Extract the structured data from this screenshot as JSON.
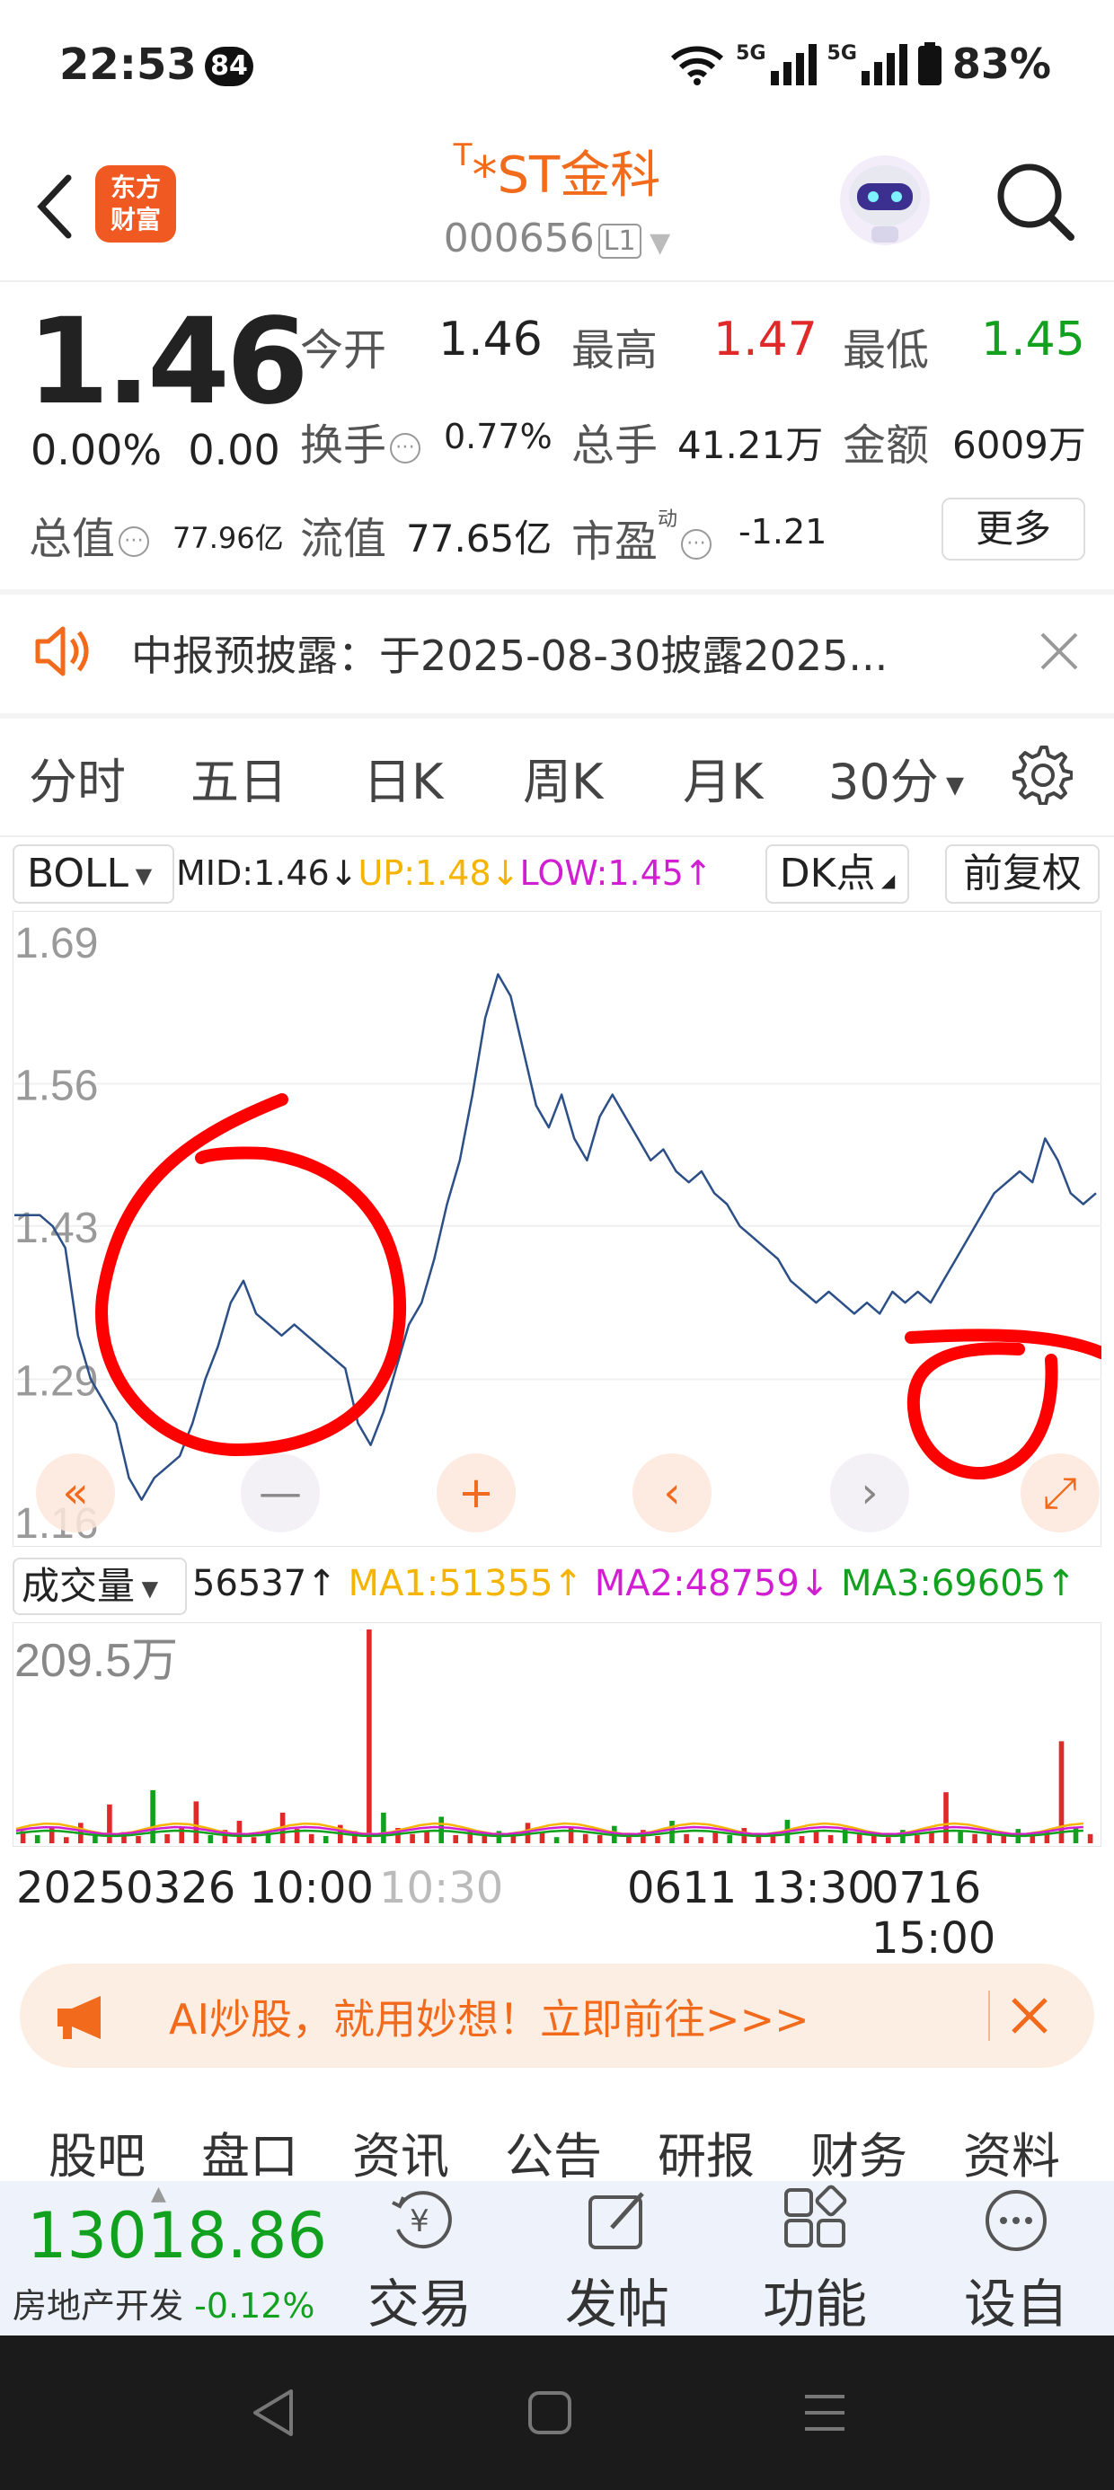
{
  "status_bar": {
    "time": "22:53",
    "badge": "84",
    "net1": "5G",
    "net2": "5G",
    "battery": "83%"
  },
  "header": {
    "logo_line1": "东方",
    "logo_line2": "财富",
    "title_prefix": "T",
    "title": "*ST金科",
    "code": "000656",
    "level": "L1"
  },
  "quote": {
    "price": "1.46",
    "change_pct": "0.00%",
    "change": "0.00",
    "open_label": "今开",
    "open": "1.46",
    "high_label": "最高",
    "high": "1.47",
    "low_label": "最低",
    "low": "1.45",
    "turnover_label": "换手",
    "turnover": "0.77%",
    "volume_label": "总手",
    "volume": "41.21万",
    "amount_label": "金额",
    "amount": "6009万",
    "mktcap_label": "总值",
    "mktcap": "77.96亿",
    "float_label": "流值",
    "float_cap": "77.65亿",
    "pe_label": "市盈",
    "pe_sup": "动",
    "pe": "-1.21",
    "more": "更多"
  },
  "notice": {
    "text": "中报预披露：于2025-08-30披露2025..."
  },
  "period_tabs": {
    "items": [
      "分时",
      "五日",
      "日K",
      "周K",
      "月K",
      "30分"
    ],
    "active": "30分"
  },
  "indicator": {
    "name": "BOLL",
    "mid": "MID:1.46↓",
    "up": "UP:1.48↓",
    "low": "LOW:1.45↑",
    "dk": "DK点",
    "adjust": "前复权"
  },
  "volume_indicator": {
    "name": "成交量",
    "value": "56537↑",
    "ma1": "MA1:51355↑",
    "ma2": "MA2:48759↓",
    "ma3": "MA3:69605↑",
    "max_label": "209.5万"
  },
  "dates": {
    "d1": "20250326 10:00",
    "d2": "10:30",
    "d3": "0611 13:30",
    "d4": "0716 15:00"
  },
  "colors": {
    "accent": "#f26a1b",
    "up": "#e02a2a",
    "down": "#12a11f",
    "line": "#2b4f86",
    "annotation": "#ff0000"
  },
  "chart_data": {
    "type": "line",
    "title": "",
    "ylabel": "",
    "ylim": [
      1.16,
      1.69
    ],
    "y_ticks": [
      "1.69",
      "1.56",
      "1.43",
      "1.29",
      "1.16"
    ],
    "series": [
      {
        "values": [
          1.44,
          1.44,
          1.44,
          1.43,
          1.41,
          1.33,
          1.29,
          1.27,
          1.25,
          1.2,
          1.18,
          1.2,
          1.21,
          1.22,
          1.25,
          1.29,
          1.32,
          1.36,
          1.38,
          1.35,
          1.34,
          1.33,
          1.34,
          1.33,
          1.32,
          1.31,
          1.3,
          1.25,
          1.23,
          1.26,
          1.3,
          1.34,
          1.36,
          1.4,
          1.45,
          1.49,
          1.55,
          1.62,
          1.66,
          1.64,
          1.59,
          1.54,
          1.52,
          1.55,
          1.51,
          1.49,
          1.53,
          1.55,
          1.53,
          1.51,
          1.49,
          1.5,
          1.48,
          1.47,
          1.48,
          1.46,
          1.45,
          1.43,
          1.42,
          1.41,
          1.4,
          1.38,
          1.37,
          1.36,
          1.37,
          1.36,
          1.35,
          1.36,
          1.35,
          1.37,
          1.36,
          1.37,
          1.36,
          1.38,
          1.4,
          1.42,
          1.44,
          1.46,
          1.47,
          1.48,
          1.47,
          1.51,
          1.49,
          1.46,
          1.45,
          1.46
        ]
      }
    ],
    "volume": {
      "ylim": [
        0,
        2095000
      ],
      "values": [
        120000,
        80000,
        150000,
        60000,
        200000,
        90000,
        380000,
        110000,
        70000,
        520000,
        90000,
        160000,
        410000,
        80000,
        130000,
        220000,
        60000,
        100000,
        300000,
        140000,
        90000,
        70000,
        180000,
        120000,
        2095000,
        300000,
        150000,
        90000,
        110000,
        260000,
        80000,
        140000,
        70000,
        120000,
        90000,
        200000,
        110000,
        60000,
        150000,
        90000,
        80000,
        170000,
        100000,
        130000,
        70000,
        220000,
        90000,
        60000,
        120000,
        80000,
        150000,
        100000,
        90000,
        230000,
        70000,
        110000,
        80000,
        140000,
        100000,
        90000,
        60000,
        130000,
        80000,
        120000,
        500000,
        110000,
        90000,
        100000,
        80000,
        140000,
        70000,
        120000,
        1000000,
        160000,
        90000
      ]
    }
  },
  "ad": {
    "text": "AI炒股，就用妙想！立即前往>>>"
  },
  "sub_tabs": {
    "items": [
      "股吧",
      "盘口",
      "资讯",
      "公告",
      "研报",
      "财务",
      "资料"
    ],
    "active": "股吧"
  },
  "bottom_bar": {
    "index_value": "13018.86",
    "index_name": "房地产开发",
    "index_change": "-0.12%",
    "trade": "交易",
    "post": "发帖",
    "func": "功能",
    "watch": "设自选",
    "trade_icon": "¥"
  }
}
